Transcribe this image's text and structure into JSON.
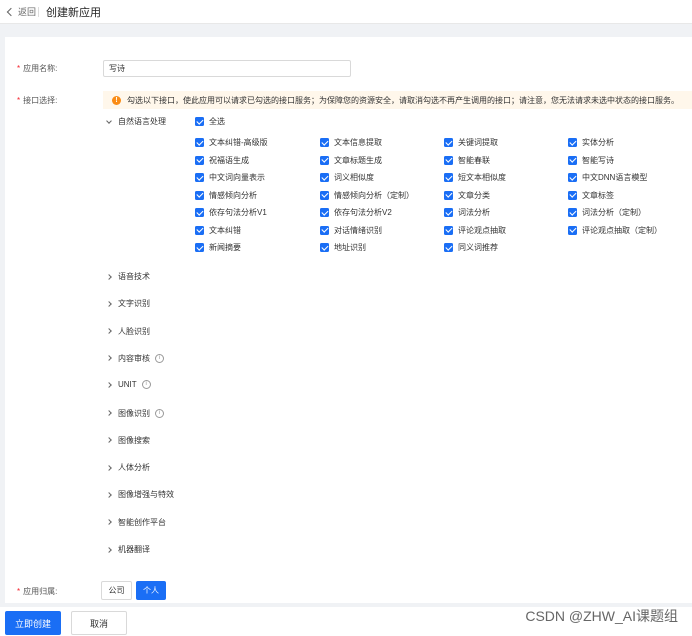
{
  "header": {
    "back_label": "返回",
    "title": "创建新应用"
  },
  "form": {
    "app_name_label": "应用名称:",
    "app_name_value": "写诗",
    "api_select_label": "接口选择:",
    "notice": "勾选以下接口，使此应用可以请求已勾选的接口服务；为保障您的资源安全，请取消勾选不再产生调用的接口；请注意，您无法请求未选中状态的接口服务。",
    "nlp_category": "自然语言处理",
    "select_all": "全选",
    "nlp_apis": [
      "文本纠错-高级版",
      "文本信息提取",
      "关键词提取",
      "实体分析",
      "祝福语生成",
      "文章标题生成",
      "智能春联",
      "智能写诗",
      "中文词向量表示",
      "词义相似度",
      "短文本相似度",
      "中文DNN语言模型",
      "情感倾向分析",
      "情感倾向分析（定制）",
      "文章分类",
      "文章标签",
      "依存句法分析V1",
      "依存句法分析V2",
      "词法分析",
      "词法分析（定制）",
      "文本纠错",
      "对话情绪识别",
      "评论观点抽取",
      "评论观点抽取（定制）",
      "新闻摘要",
      "地址识别",
      "同义词推荐"
    ],
    "categories": [
      {
        "label": "语音技术",
        "info": false
      },
      {
        "label": "文字识别",
        "info": false
      },
      {
        "label": "人脸识别",
        "info": false
      },
      {
        "label": "内容审核",
        "info": true
      },
      {
        "label": "UNIT",
        "info": true
      },
      {
        "label": "图像识别",
        "info": true
      },
      {
        "label": "图像搜索",
        "info": false
      },
      {
        "label": "人体分析",
        "info": false
      },
      {
        "label": "图像增强与特效",
        "info": false
      },
      {
        "label": "智能创作平台",
        "info": false
      },
      {
        "label": "机器翻译",
        "info": false
      }
    ],
    "ownership_label": "应用归属:",
    "ownership_options": [
      "公司",
      "个人"
    ],
    "ownership_selected": "个人"
  },
  "footer": {
    "create_label": "立即创建",
    "cancel_label": "取消"
  },
  "watermark": "CSDN @ZHW_AI课题组",
  "colors": {
    "primary": "#1a6ef5",
    "warning_bg": "#fff7eb",
    "warning_icon": "#fa8c16"
  },
  "icons": {
    "notice": "exclamation-circle-icon",
    "info": "info-circle-icon",
    "back": "chevron-left-icon"
  }
}
